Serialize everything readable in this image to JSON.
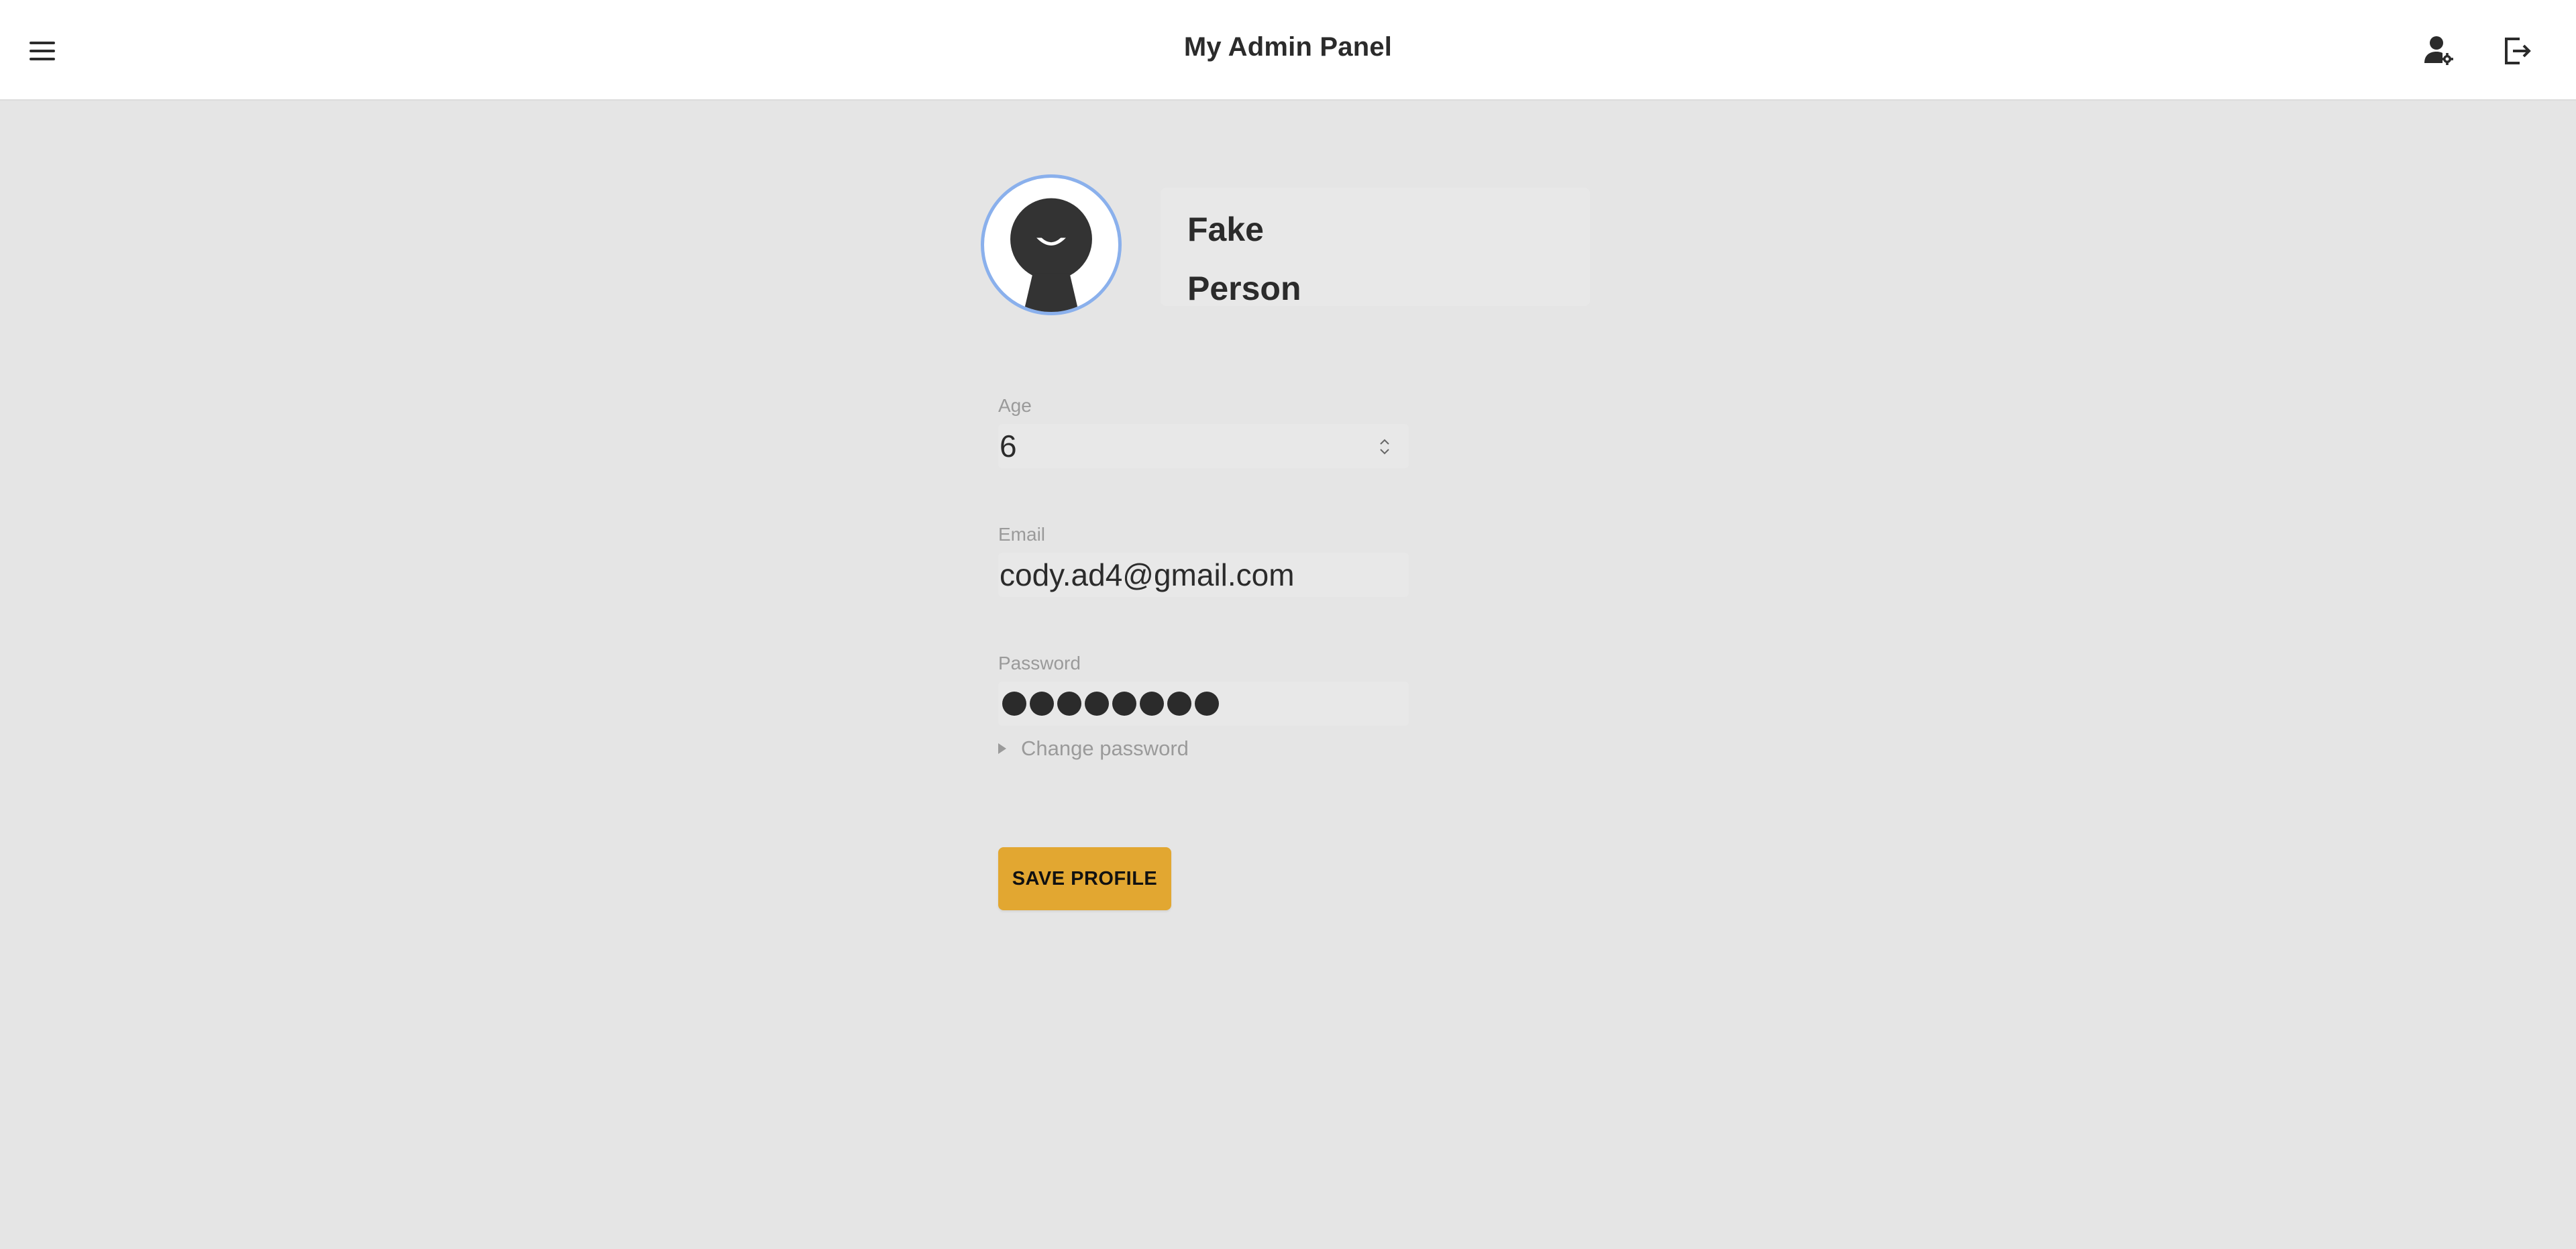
{
  "header": {
    "title": "My Admin Panel",
    "menu_icon": "hamburger-menu-icon",
    "profile_icon": "user-settings-icon",
    "logout_icon": "logout-icon"
  },
  "profile": {
    "first_name": "Fake",
    "last_name": "Person",
    "avatar_icon": "avatar-placeholder-icon"
  },
  "form": {
    "age": {
      "label": "Age",
      "value": "6"
    },
    "email": {
      "label": "Email",
      "value": "cody.ad4@gmail.com"
    },
    "password": {
      "label": "Password",
      "masked_length": 8
    },
    "change_password_label": "Change password",
    "save_label": "SAVE PROFILE"
  },
  "colors": {
    "background": "#e5e5e5",
    "topbar": "#ffffff",
    "accent": "#e2a731",
    "avatar_ring": "#8ab0ec",
    "text": "#2b2b2b",
    "muted_text": "#9a9a9a"
  }
}
